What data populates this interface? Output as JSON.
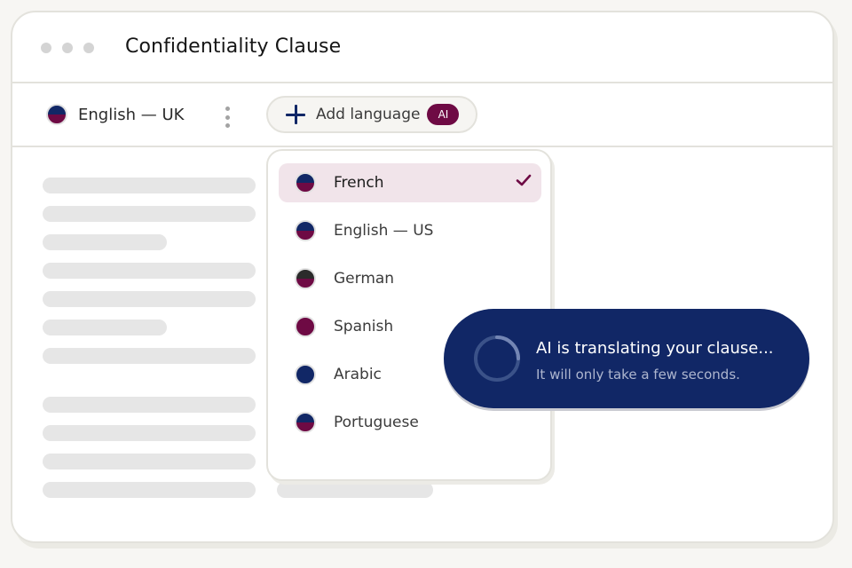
{
  "window": {
    "title": "Confidentiality Clause"
  },
  "toolbar": {
    "current_language": {
      "label": "English — UK",
      "flag": "uk-flag-icon"
    },
    "add_language_label": "Add language",
    "ai_badge": "AI"
  },
  "dropdown": {
    "items": [
      {
        "label": "French",
        "selected": true
      },
      {
        "label": "English — US",
        "selected": false
      },
      {
        "label": "German",
        "selected": false
      },
      {
        "label": "Spanish",
        "selected": false
      },
      {
        "label": "Arabic",
        "selected": false
      },
      {
        "label": "Portuguese",
        "selected": false
      }
    ]
  },
  "toast": {
    "title": "AI is translating your clause...",
    "subtitle": "It will only take a few seconds."
  },
  "colors": {
    "navy": "#112766",
    "burgundy": "#6e0a44",
    "selected_bg": "#f1e4ea"
  }
}
